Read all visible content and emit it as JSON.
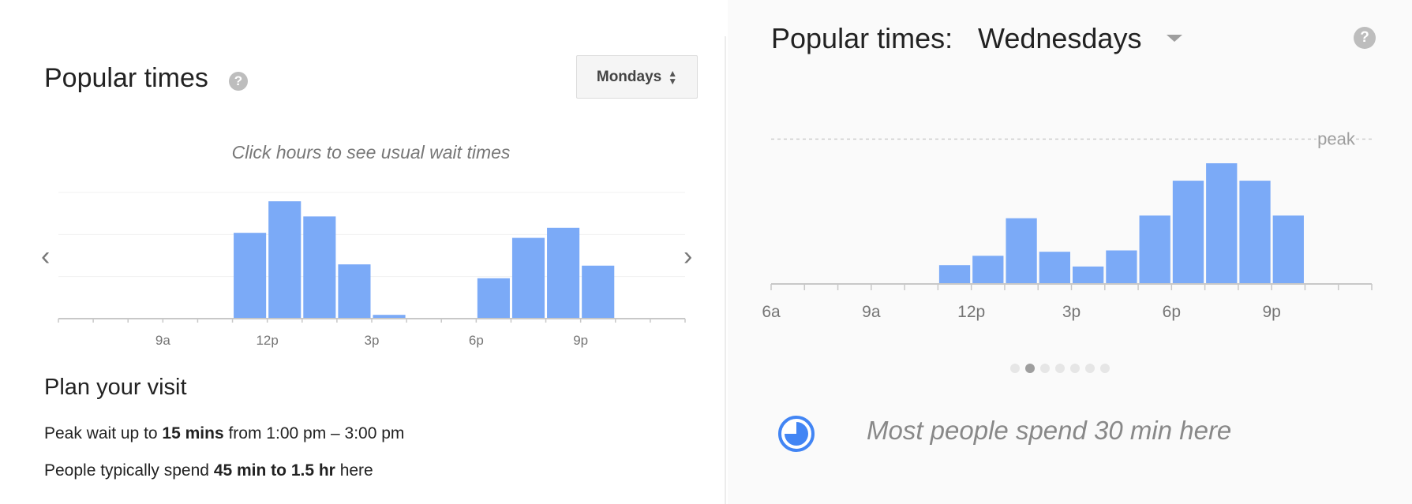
{
  "left_panel": {
    "title": "Popular times",
    "help_icon": "question-icon",
    "day_select": "Mondays",
    "hint": "Click hours to see usual wait times",
    "prev_icon": "chevron-left-icon",
    "next_icon": "chevron-right-icon",
    "plan_title": "Plan your visit",
    "wait_line": {
      "pre": "Peak wait up to ",
      "bold": "15 mins",
      "post": " from 1:00 pm – 3:00 pm"
    },
    "spend_line": {
      "pre": "People typically spend ",
      "bold": "45 min to 1.5 hr",
      "post": " here"
    }
  },
  "right_panel": {
    "title": "Popular times:",
    "day": "Wednesdays",
    "help_icon": "question-icon",
    "caret_icon": "caret-down-icon",
    "peak_label": "peak",
    "page_dots": 7,
    "active_dot": 1,
    "clock_icon": "clock-icon",
    "spend_text": "Most people spend 30 min here"
  },
  "colors": {
    "bar": "#7baaf7",
    "accent": "#4285f4",
    "axis": "#c8c8c8",
    "tick_text": "#757575"
  },
  "chart_data": [
    {
      "type": "bar",
      "title": "Popular times",
      "subtitle": "Mondays",
      "x_labels": {
        "9a": 9,
        "12p": 12,
        "3p": 15,
        "6p": 18,
        "9p": 21
      },
      "x_range": [
        6,
        24
      ],
      "y_range": [
        0,
        100
      ],
      "grid": true,
      "hours": [
        11,
        12,
        13,
        14,
        15,
        18,
        19,
        20,
        21
      ],
      "values": [
        68,
        93,
        81,
        43,
        3,
        32,
        64,
        72,
        42
      ]
    },
    {
      "type": "bar",
      "title": "Popular times: Wednesdays",
      "x_labels": {
        "6a": 6,
        "9a": 9,
        "12p": 12,
        "3p": 15,
        "6p": 18,
        "9p": 21
      },
      "x_range": [
        6,
        24
      ],
      "y_range": [
        0,
        100
      ],
      "peak_line": "peak",
      "hours": [
        11,
        12,
        13,
        14,
        15,
        16,
        17,
        18,
        19,
        20,
        21
      ],
      "values": [
        14,
        21,
        49,
        24,
        13,
        25,
        51,
        77,
        90,
        77,
        51
      ]
    }
  ]
}
